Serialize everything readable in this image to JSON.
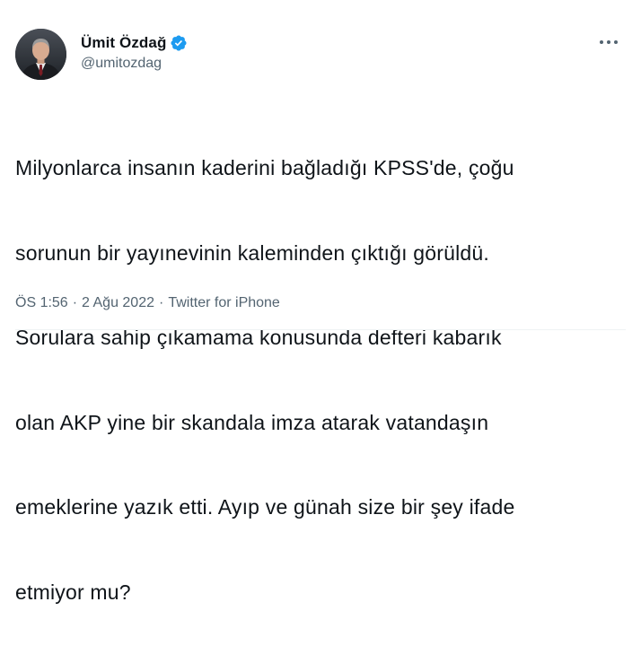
{
  "author": {
    "name": "Ümit Özdağ",
    "handle": "@umitozdag",
    "verified": true
  },
  "tweet": {
    "lines": [
      "Milyonlarca insanın kaderini bağladığı KPSS'de, çoğu",
      "sorunun bir yayınevinin kaleminden çıktığı görüldü.",
      "Sorulara sahip çıkamama konusunda defteri kabarık",
      "olan AKP yine bir skandala imza atarak vatandaşın",
      "emeklerine yazık etti. Ayıp ve günah size bir şey ifade",
      "etmiyor mu?"
    ]
  },
  "meta": {
    "time": "ÖS 1:56",
    "separator": "·",
    "date": "2 Ağu 2022",
    "source": "Twitter for iPhone"
  },
  "icons": {
    "verified": "verified-badge-icon",
    "more": "more-options-icon"
  },
  "colors": {
    "text": "#0f1419",
    "secondary": "#536471",
    "verified": "#1d9bf0"
  }
}
